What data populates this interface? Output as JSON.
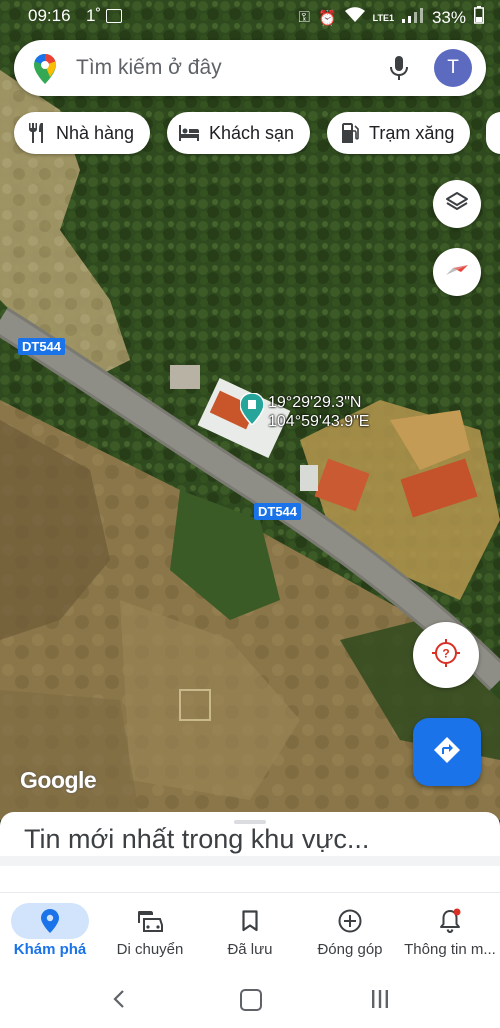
{
  "status_bar": {
    "time": "09:16",
    "extra": "1˚",
    "battery": "33%",
    "network": "LTE1"
  },
  "search": {
    "placeholder": "Tìm kiếm ở đây",
    "avatar_letter": "T"
  },
  "chips": [
    {
      "label": "Nhà hàng",
      "icon": "restaurant-icon"
    },
    {
      "label": "Khách sạn",
      "icon": "hotel-icon"
    },
    {
      "label": "Trạm xăng",
      "icon": "gas-station-icon"
    }
  ],
  "map": {
    "road_labels": [
      "DT544",
      "DT544"
    ],
    "coordinates": {
      "lat": "19°29'29.3\"N",
      "lng": "104°59'43.9\"E"
    },
    "attribution": "Google"
  },
  "sheet": {
    "title": "Tin mới nhất trong khu vực..."
  },
  "bottom_nav": [
    {
      "label": "Khám phá",
      "icon": "explore-pin-icon",
      "active": true
    },
    {
      "label": "Di chuyển",
      "icon": "commute-icon",
      "active": false
    },
    {
      "label": "Đã lưu",
      "icon": "bookmark-icon",
      "active": false
    },
    {
      "label": "Đóng góp",
      "icon": "add-circle-icon",
      "active": false
    },
    {
      "label": "Thông tin m...",
      "icon": "notifications-icon",
      "active": false
    }
  ],
  "colors": {
    "accent": "#1a73e8",
    "pin": "#26a69a",
    "avatar": "#5c6bc0"
  }
}
